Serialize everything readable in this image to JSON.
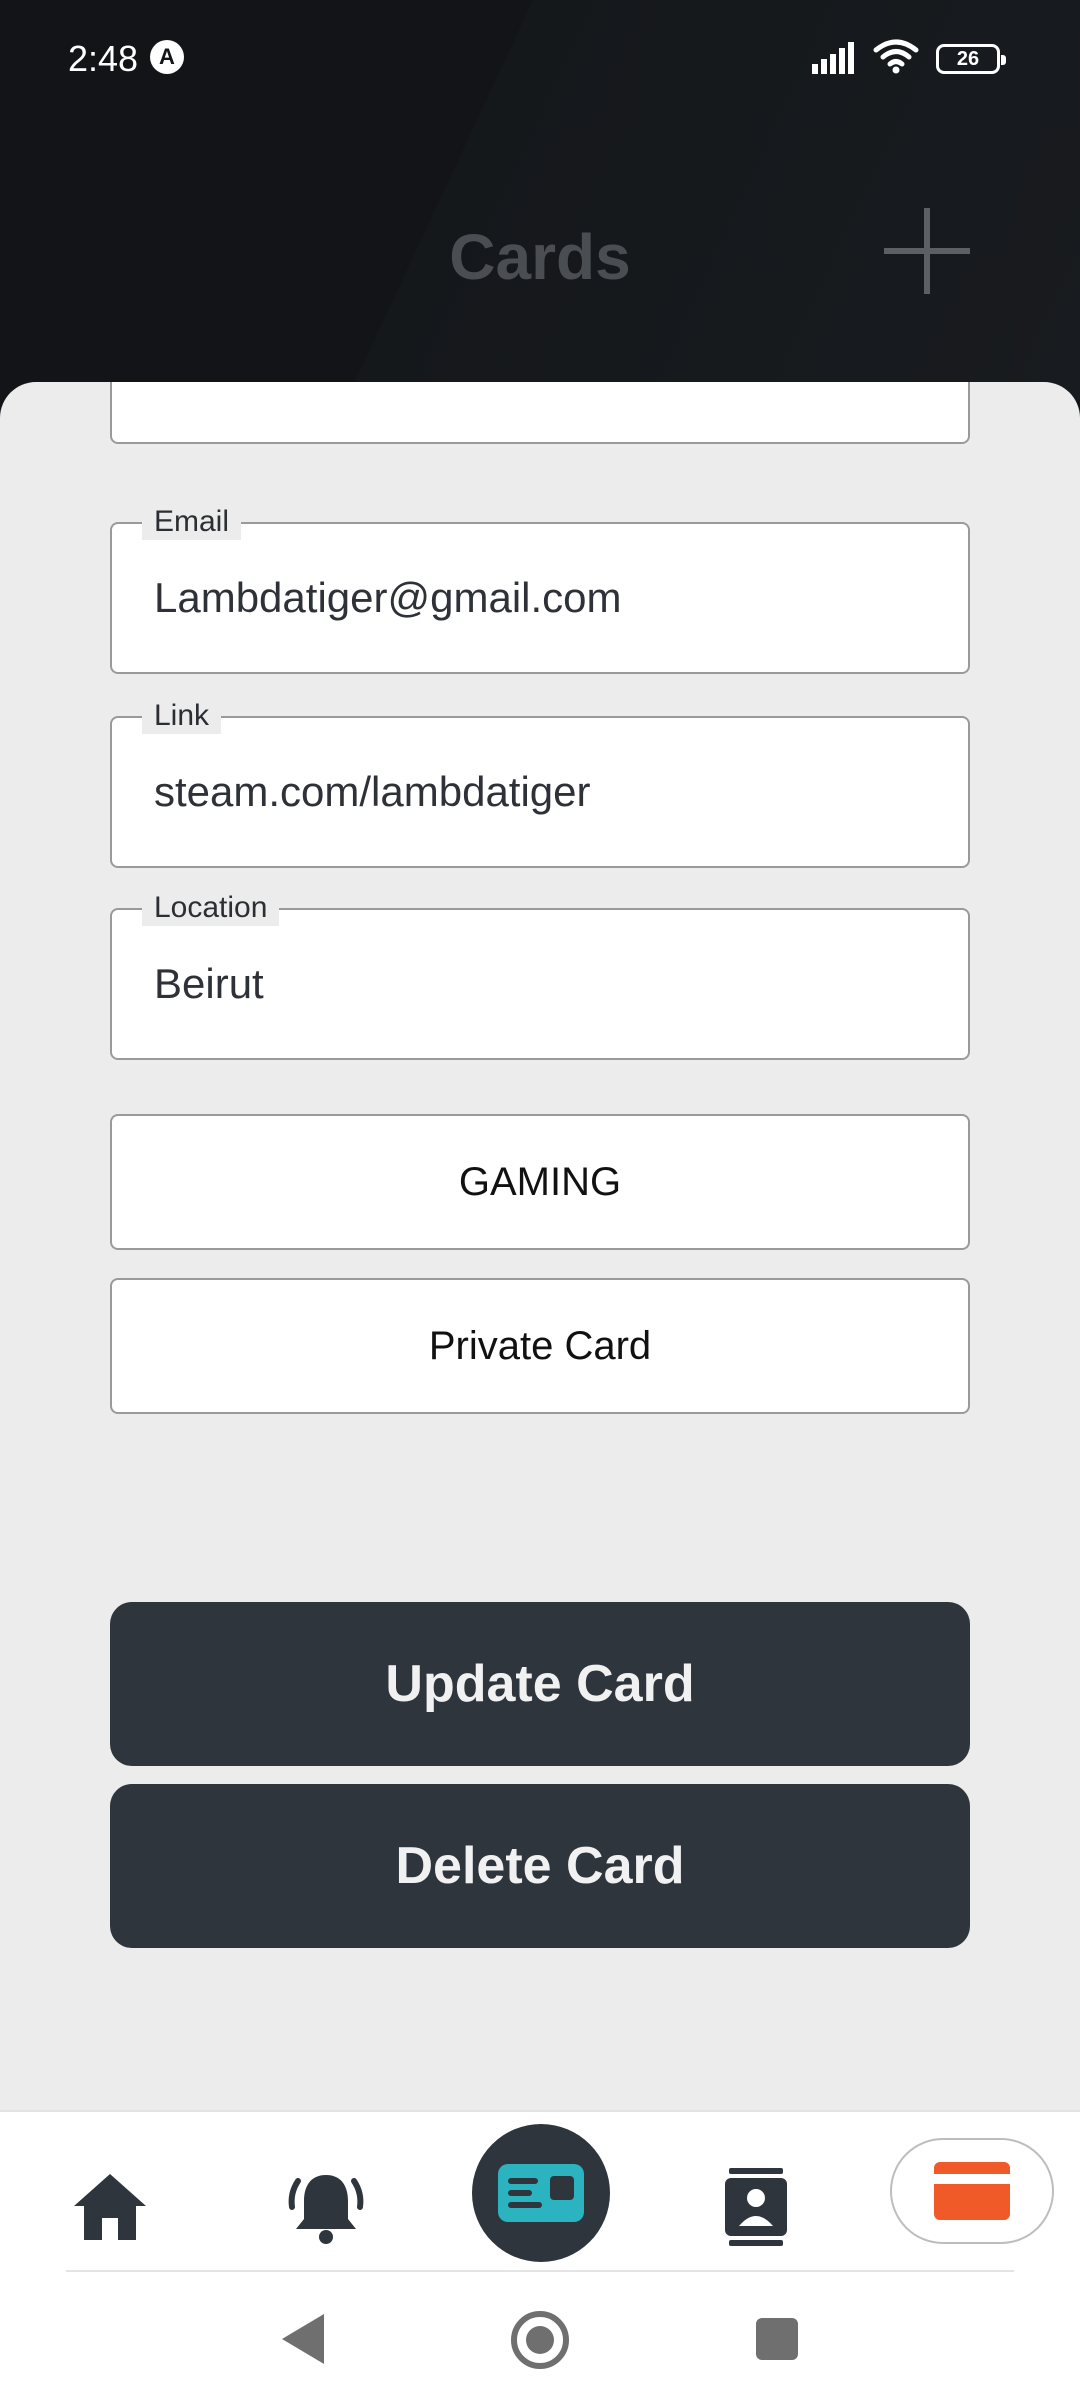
{
  "status_bar": {
    "time": "2:48",
    "notification_glyph": "A",
    "battery": "26"
  },
  "header": {
    "title": "Cards"
  },
  "form": {
    "email": {
      "label": "Email",
      "value": "Lambdatiger@gmail.com"
    },
    "link": {
      "label": "Link",
      "value": "steam.com/lambdatiger"
    },
    "location": {
      "label": "Location",
      "value": "Beirut"
    },
    "category_button": "GAMING",
    "privacy_button": "Private Card"
  },
  "actions": {
    "update": "Update Card",
    "delete": "Delete Card"
  },
  "bottom_nav": {
    "items": [
      "home-icon",
      "bell-icon",
      "card-icon",
      "contact-icon",
      "credit-card-icon"
    ],
    "active": "card-icon"
  },
  "colors": {
    "header_bg": "#121417",
    "sheet_bg": "#ececec",
    "button_dark": "#2f353d",
    "accent_teal": "#2bb3c0",
    "accent_orange": "#f05a28"
  }
}
